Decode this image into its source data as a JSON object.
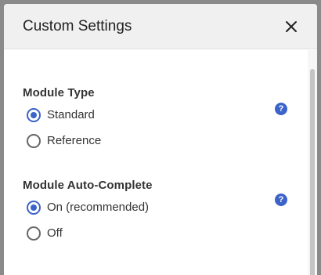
{
  "dialog": {
    "title": "Custom Settings",
    "close_icon": "close-icon"
  },
  "sections": [
    {
      "label": "Module Type",
      "help_glyph": "?",
      "options": [
        {
          "label": "Standard",
          "selected": true
        },
        {
          "label": "Reference",
          "selected": false
        }
      ]
    },
    {
      "label": "Module Auto-Complete",
      "help_glyph": "?",
      "options": [
        {
          "label": "On (recommended)",
          "selected": true
        },
        {
          "label": "Off",
          "selected": false
        }
      ]
    }
  ],
  "colors": {
    "accent": "#3b63c9",
    "header_bg": "#f0f0f0",
    "backdrop": "#8a8a8a"
  }
}
